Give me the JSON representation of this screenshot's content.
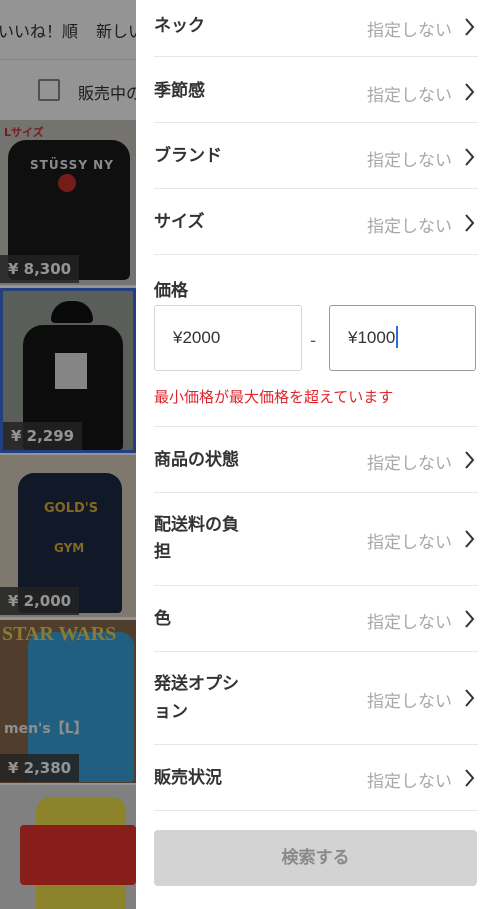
{
  "background": {
    "tabs": [
      "いいね！順",
      "新しい"
    ],
    "filter_label": "販売中の",
    "size_tag": "Lサイズ",
    "prices": [
      "¥ 8,300",
      "¥ 2,299",
      "¥ 2,000",
      "¥ 2,380"
    ],
    "print_text": {
      "stussy": "STÜSSY NY",
      "golds": "GOLD'S",
      "gym": "GYM",
      "starwars": "STAR WARS",
      "mens": "men's【L】"
    }
  },
  "filters": {
    "neck": {
      "label": "ネック",
      "value": "指定しない"
    },
    "season": {
      "label": "季節感",
      "value": "指定しない"
    },
    "brand": {
      "label": "ブランド",
      "value": "指定しない"
    },
    "size": {
      "label": "サイズ",
      "value": "指定しない"
    },
    "price": {
      "label": "価格",
      "min": "¥2000",
      "separator": "-",
      "max": "¥1000",
      "error": "最小価格が最大価格を超えています"
    },
    "condition": {
      "label": "商品の状態",
      "value": "指定しない"
    },
    "shipping_fee": {
      "label_line1": "配送料の負",
      "label_line2": "担",
      "value": "指定しない"
    },
    "color": {
      "label": "色",
      "value": "指定しない"
    },
    "shipping_option": {
      "label_line1": "発送オプシ",
      "label_line2": "ョン",
      "value": "指定しない"
    },
    "sales_status": {
      "label": "販売状況",
      "value": "指定しない"
    }
  },
  "search_button": "検索する",
  "colors": {
    "error": "#e0262d",
    "muted": "#a8a8a8",
    "caret": "#2a6fdb",
    "disabled_button": "#d3d3d3",
    "highlight_border": "#3a6fd8"
  }
}
